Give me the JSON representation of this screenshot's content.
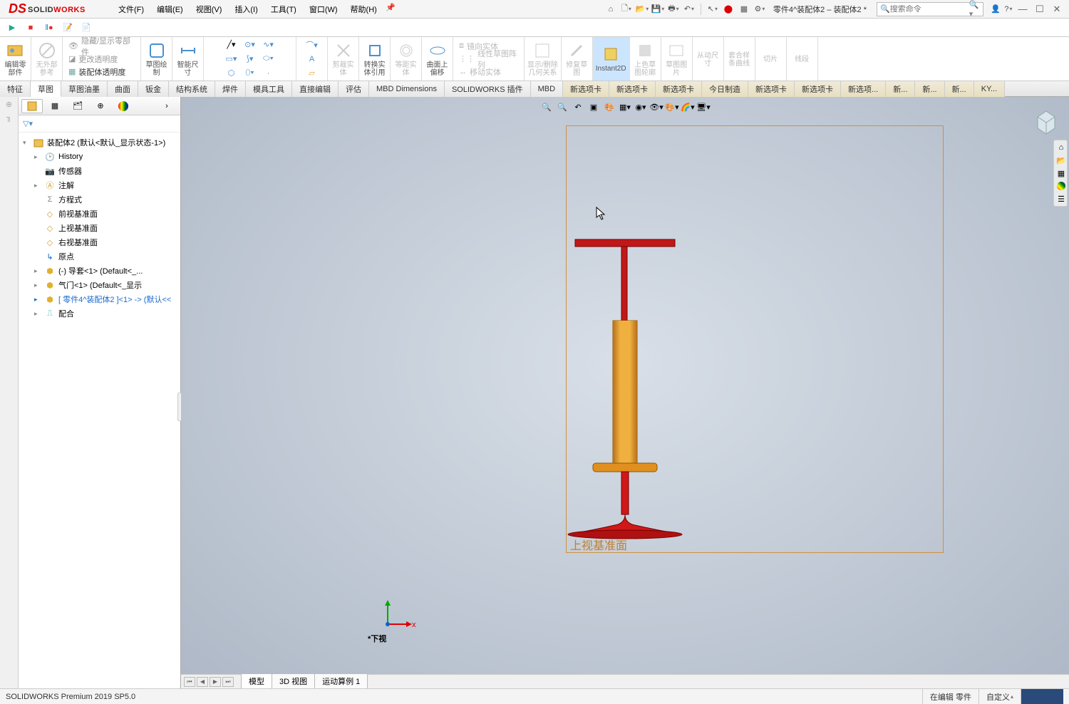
{
  "app": {
    "logo_solid": "SOLID",
    "logo_works": "WORKS",
    "doc_title": "零件4^装配体2 – 装配体2 *",
    "search_placeholder": "搜索命令"
  },
  "menus": [
    "文件(F)",
    "编辑(E)",
    "视图(V)",
    "插入(I)",
    "工具(T)",
    "窗口(W)",
    "帮助(H)"
  ],
  "ribbon": {
    "edit_part": "编辑零\n部件",
    "no_ext_ref": "无外部\n参考",
    "hide_show": "隐藏/显示零部件",
    "more_trans": "更改透明度",
    "asm_trans": "装配体透明度",
    "sketch_draw": "草图绘\n制",
    "smart_dim": "智能尺\n寸",
    "trim": "剪裁实\n体",
    "convert": "转换实\n体引用",
    "equidist": "等距实\n体",
    "surf_off": "曲面上\n偏移",
    "mirror": "镜向实体",
    "linear": "线性草图阵列",
    "move": "移动实体",
    "show_del": "显示/删除\n几何关系",
    "repair": "修复草\n图",
    "instant2d": "Instant2D",
    "shade_sketch": "上色草\n图轮廓",
    "sketch_pic": "草图图\n片",
    "driven_dim": "从动尺\n寸",
    "fit_spline": "套合样\n条曲线",
    "slice": "切片",
    "segment": "线段"
  },
  "tabs": [
    "特征",
    "草图",
    "草图油墨",
    "曲面",
    "钣金",
    "结构系统",
    "焊件",
    "模具工具",
    "直接编辑",
    "评估",
    "MBD Dimensions",
    "SOLIDWORKS 插件",
    "MBD",
    "新选项卡",
    "新选项卡",
    "新选项卡",
    "今日制造",
    "新选项卡",
    "新选项卡",
    "新选项...",
    "新...",
    "新...",
    "新...",
    "KY..."
  ],
  "active_tab_index": 1,
  "tree": {
    "root": "装配体2  (默认<默认_显示状态-1>)",
    "items": [
      {
        "icon": "history",
        "label": "History",
        "exp": "▸"
      },
      {
        "icon": "sensor",
        "label": "传感器",
        "exp": ""
      },
      {
        "icon": "annotation",
        "label": "注解",
        "exp": "▸"
      },
      {
        "icon": "equation",
        "label": "方程式",
        "exp": ""
      },
      {
        "icon": "plane",
        "label": "前视基准面",
        "exp": ""
      },
      {
        "icon": "plane",
        "label": "上视基准面",
        "exp": ""
      },
      {
        "icon": "plane",
        "label": "右视基准面",
        "exp": ""
      },
      {
        "icon": "origin",
        "label": "原点",
        "exp": ""
      },
      {
        "icon": "part",
        "label": "(-) 导套<1> (Default<<Default>_...",
        "exp": "▸"
      },
      {
        "icon": "part",
        "label": "气门<1> (Default<<Default>_显示",
        "exp": "▸"
      },
      {
        "icon": "part",
        "label": "[ 零件4^装配体2 ]<1> -> (默认<<",
        "exp": "▸",
        "active": true
      },
      {
        "icon": "mates",
        "label": "配合",
        "exp": "▸"
      }
    ]
  },
  "viewport": {
    "plane_label": "上视基准面",
    "view_label": "*下视"
  },
  "bottom_tabs": [
    "模型",
    "3D 视图",
    "运动算例 1"
  ],
  "status": {
    "product": "SOLIDWORKS Premium 2019 SP5.0",
    "editing": "在编辑 零件",
    "custom": "自定义"
  }
}
